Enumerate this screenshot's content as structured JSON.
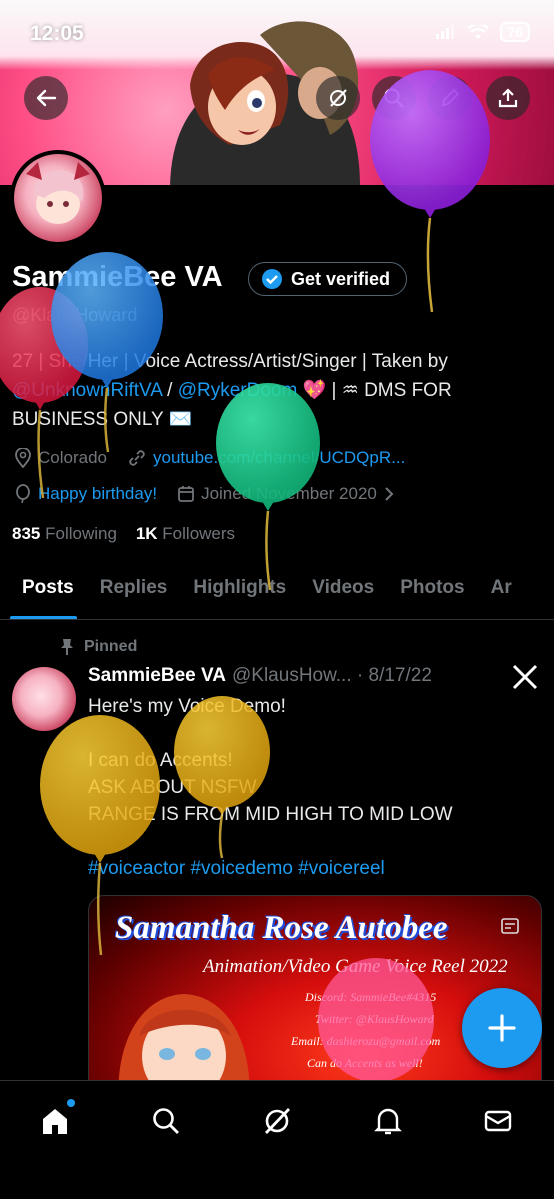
{
  "status_bar": {
    "time": "12:05",
    "battery": "76"
  },
  "profile": {
    "name": "SammieBee VA",
    "get_verified_label": "Get verified",
    "handle": "@KlausHoward",
    "bio": {
      "line1": "27 | She/Her | Voice Actress/Artist/Singer | Taken by",
      "mention1": "@UnknownRiftVA",
      "separator": " / ",
      "mention2": "@RykerDoom",
      "line2_rest": " 💖 | ♒ DMS FOR",
      "line3": "BUSINESS ONLY ✉️"
    },
    "location": "Colorado",
    "website": "youtube.com/channel/UCDQpR...",
    "birthday": "Happy birthday!",
    "joined": "Joined November 2020",
    "following_count": "835",
    "following_label": "Following",
    "followers_count": "1K",
    "followers_label": "Followers"
  },
  "tabs": [
    "Posts",
    "Replies",
    "Highlights",
    "Videos",
    "Photos",
    "Ar"
  ],
  "post": {
    "pinned_label": "Pinned",
    "author": "SammieBee VA",
    "handle_date": "@KlausHow... · 8/17/22",
    "line1": "Here's my Voice Demo!",
    "line2": "I can do Accents!",
    "line3": "ASK ABOUT NSFW",
    "line4": "RANGE IS FROM MID HIGH TO MID LOW",
    "hashtags": "#voiceactor #voicedemo #voicereel",
    "media": {
      "title": "Samantha Rose Autobee",
      "subtitle": "Animation/Video Game Voice Reel 2022",
      "discord": "Discord: SammieBee#4315",
      "twitter": "Twitter: @KlausHoward",
      "email": "Email: dashierozu@gmail.com",
      "accents": "Can do Accents as well!"
    }
  },
  "icons": {
    "back": "arrow-left-icon",
    "grok": "grok-icon",
    "search": "search-icon",
    "edit": "pencil-icon",
    "share": "share-icon",
    "home": "home-icon",
    "nav_search": "search-icon",
    "nav_grok": "grok-icon",
    "notifications": "bell-icon",
    "messages": "mail-icon",
    "compose": "plus-icon"
  },
  "colors": {
    "accent": "#1d9bf0",
    "background": "#000000",
    "muted": "#71767b"
  }
}
